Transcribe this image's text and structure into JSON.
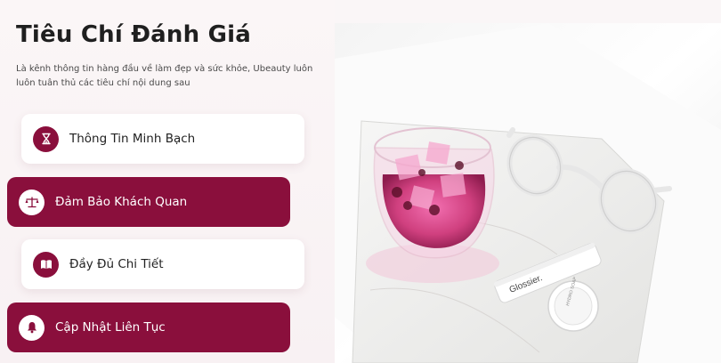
{
  "header": {
    "title": "Tiêu Chí Đánh Giá",
    "description": "Là kênh thông tin hàng đầu về làm đẹp và sức khỏe, Ubeauty luôn luôn tuân thủ các tiêu chí nội dung sau"
  },
  "criteria": [
    {
      "label": "Thông Tin Minh Bạch",
      "icon": "hourglass-icon"
    },
    {
      "label": "Đảm Bảo Khách Quan",
      "icon": "scale-icon"
    },
    {
      "label": "Đầy Đủ Chi Tiết",
      "icon": "book-icon"
    },
    {
      "label": "Cập Nhật Liên Tục",
      "icon": "bell-icon"
    }
  ],
  "photo": {
    "tube_text": "Glossier.",
    "jar_text": "HYDRO SOAP"
  },
  "colors": {
    "accent": "#8a0f3c",
    "card_white": "#ffffff",
    "background": "#faf6f7"
  }
}
